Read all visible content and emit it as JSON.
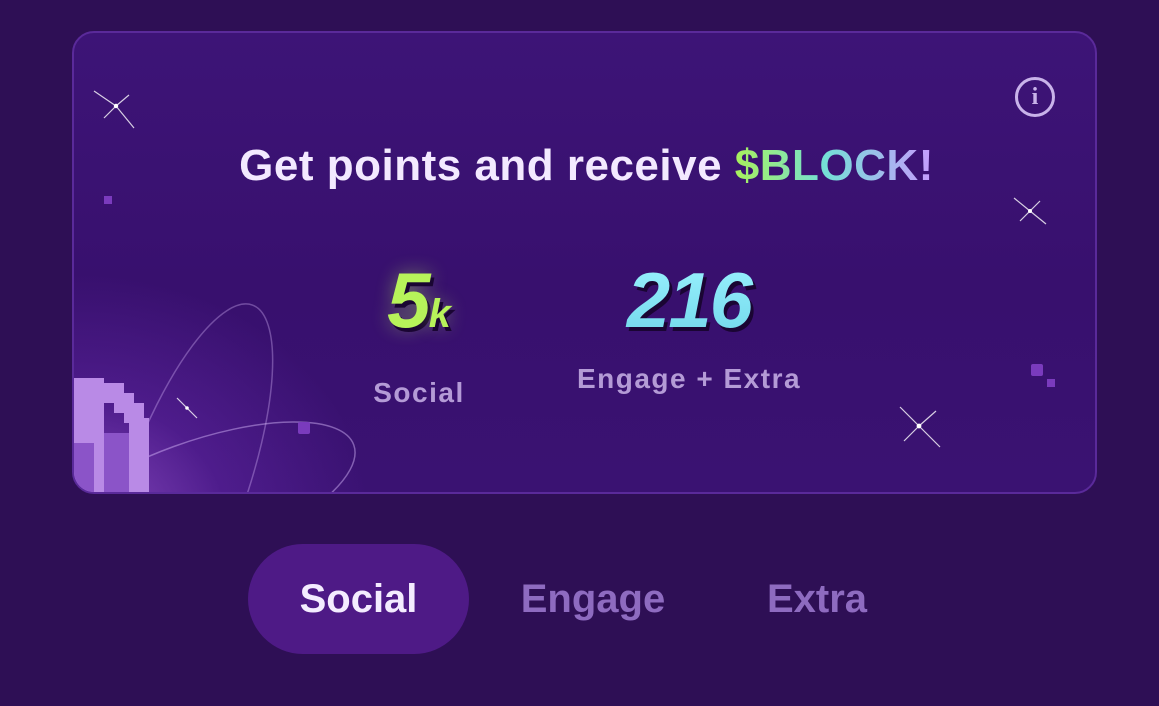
{
  "card": {
    "headline_prefix": "Get points and receive ",
    "headline_accent": "$BLOCK!",
    "info_icon": "info-icon",
    "stats": [
      {
        "value": "5",
        "unit": "k",
        "label": "Social"
      },
      {
        "value": "216",
        "label": "Engage + Extra"
      }
    ]
  },
  "tabs": [
    {
      "label": "Social",
      "active": true
    },
    {
      "label": "Engage",
      "active": false
    },
    {
      "label": "Extra",
      "active": false
    }
  ],
  "colors": {
    "background": "#2e0f55",
    "card": "#3d1477",
    "social_accent": "#b7f35a",
    "engage_accent": "#8fe8f5",
    "tab_active": "#4e1a86",
    "tab_inactive_text": "#8e6bc0"
  }
}
